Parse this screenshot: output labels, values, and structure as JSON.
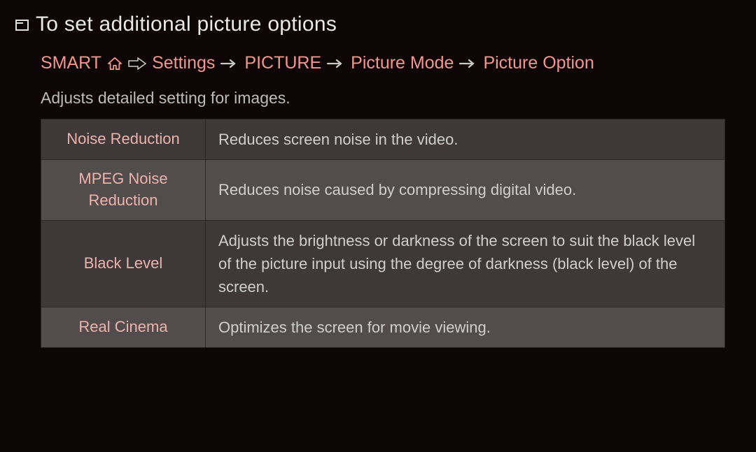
{
  "title": "To set additional picture options",
  "breadcrumb": {
    "smart": "SMART",
    "settings": "Settings",
    "picture": "PICTURE",
    "picture_mode": "Picture Mode",
    "picture_option": "Picture Option"
  },
  "description": "Adjusts detailed setting for images.",
  "options": [
    {
      "name": "Noise Reduction",
      "desc": "Reduces screen noise in the video."
    },
    {
      "name": "MPEG Noise Reduction",
      "desc": "Reduces noise caused by compressing digital video."
    },
    {
      "name": "Black Level",
      "desc": "Adjusts the brightness or darkness of the screen to suit the black level of the picture input using the degree of darkness (black level) of the screen."
    },
    {
      "name": "Real Cinema",
      "desc": "Optimizes the screen for movie viewing."
    }
  ]
}
